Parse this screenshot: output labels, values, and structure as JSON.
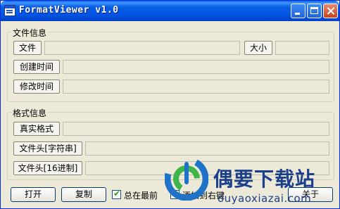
{
  "window": {
    "title": "FormatViewer v1.0"
  },
  "file_info": {
    "group_title": "文件信息",
    "file_button": "文件",
    "size_button": "大小",
    "created_button": "创建时间",
    "modified_button": "修改时间"
  },
  "format_info": {
    "group_title": "格式信息",
    "real_format_button": "真实格式",
    "header_string_button": "文件头[字符串]",
    "header_hex_button": "文件头[16进制]"
  },
  "bottom": {
    "open_button": "打开",
    "copy_button": "复制",
    "always_on_top": {
      "label": "总在最前",
      "checked": true
    },
    "add_context_menu": {
      "label": "添加到右键",
      "checked": false
    },
    "about_button": "关于"
  },
  "watermark": {
    "text": "偶要下载站",
    "url": "ouyaoxiazai.com"
  }
}
